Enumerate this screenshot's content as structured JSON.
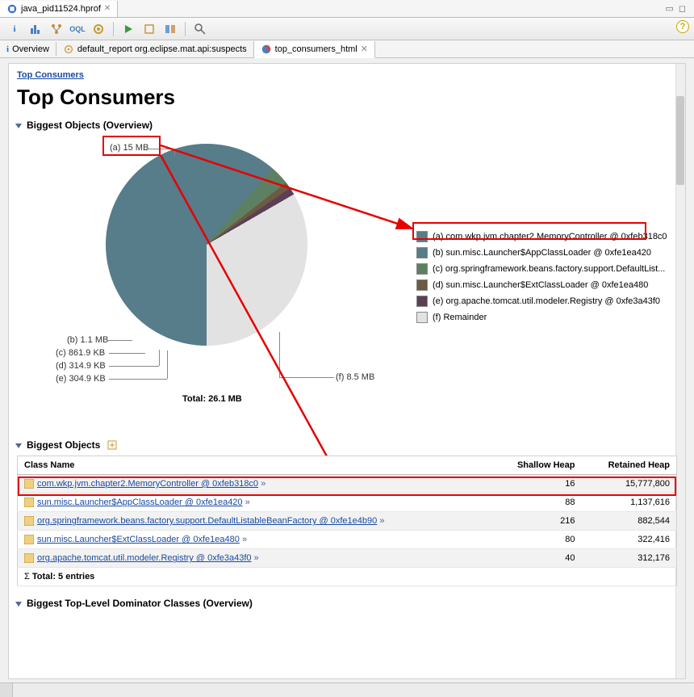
{
  "editor_tab": {
    "label": "java_pid11524.hprof"
  },
  "sub_tabs": {
    "overview": "Overview",
    "default_report": "default_report  org.eclipse.mat.api:suspects",
    "top_consumers": "top_consumers_html"
  },
  "breadcrumb": "Top Consumers",
  "page_title": "Top Consumers",
  "sections": {
    "overview": "Biggest Objects (Overview)",
    "biggest_objects": "Biggest Objects",
    "dominator": "Biggest Top-Level Dominator Classes (Overview)"
  },
  "pie": {
    "total_label": "Total: 26.1 MB",
    "labels": {
      "a": "(a)  15 MB",
      "b": "(b)  1.1 MB",
      "c": "(c)  861.9 KB",
      "d": "(d)  314.9 KB",
      "e": "(e)  304.9 KB",
      "f": "(f)  8.5 MB"
    }
  },
  "legend": [
    {
      "key": "a",
      "color": "#577c8a",
      "text": "(a)  com.wkp.jvm.chapter2.MemoryController @ 0xfeb318c0"
    },
    {
      "key": "b",
      "color": "#577c8a",
      "text": "(b)  sun.misc.Launcher$AppClassLoader @ 0xfe1ea420"
    },
    {
      "key": "c",
      "color": "#5e8062",
      "text": "(c)  org.springframework.beans.factory.support.DefaultList..."
    },
    {
      "key": "d",
      "color": "#6d5a40",
      "text": "(d)  sun.misc.Launcher$ExtClassLoader @ 0xfe1ea480"
    },
    {
      "key": "e",
      "color": "#5a3f55",
      "text": "(e)  org.apache.tomcat.util.modeler.Registry @ 0xfe3a43f0"
    },
    {
      "key": "f",
      "color": "#e2e2e2",
      "text": "(f)  Remainder"
    }
  ],
  "table": {
    "columns": {
      "name": "Class Name",
      "shallow": "Shallow Heap",
      "retained": "Retained Heap"
    },
    "rows": [
      {
        "name": "com.wkp.jvm.chapter2.MemoryController @ 0xfeb318c0",
        "shallow": "16",
        "retained": "15,777,800"
      },
      {
        "name": "sun.misc.Launcher$AppClassLoader @ 0xfe1ea420",
        "shallow": "88",
        "retained": "1,137,616"
      },
      {
        "name": "org.springframework.beans.factory.support.DefaultListableBeanFactory @ 0xfe1e4b90",
        "shallow": "216",
        "retained": "882,544"
      },
      {
        "name": "sun.misc.Launcher$ExtClassLoader @ 0xfe1ea480",
        "shallow": "80",
        "retained": "322,416"
      },
      {
        "name": "org.apache.tomcat.util.modeler.Registry @ 0xfe3a43f0",
        "shallow": "40",
        "retained": "312,176"
      }
    ],
    "total_label": "Total: 5 entries"
  },
  "chart_data": {
    "type": "pie",
    "title": "Biggest Objects (Overview)",
    "total_label": "Total: 26.1 MB",
    "total_value_mb": 26.1,
    "slices": [
      {
        "key": "a",
        "label": "com.wkp.jvm.chapter2.MemoryController @ 0xfeb318c0",
        "value_mb": 15.0,
        "display": "15 MB",
        "color": "#577c8a"
      },
      {
        "key": "b",
        "label": "sun.misc.Launcher$AppClassLoader @ 0xfe1ea420",
        "value_mb": 1.1,
        "display": "1.1 MB",
        "color": "#577c8a"
      },
      {
        "key": "c",
        "label": "org.springframework.beans.factory.support.DefaultListableBeanFactory",
        "value_mb": 0.842,
        "display": "861.9 KB",
        "color": "#5e8062"
      },
      {
        "key": "d",
        "label": "sun.misc.Launcher$ExtClassLoader @ 0xfe1ea480",
        "value_mb": 0.308,
        "display": "314.9 KB",
        "color": "#6d5a40"
      },
      {
        "key": "e",
        "label": "org.apache.tomcat.util.modeler.Registry @ 0xfe3a43f0",
        "value_mb": 0.298,
        "display": "304.9 KB",
        "color": "#5a3f55"
      },
      {
        "key": "f",
        "label": "Remainder",
        "value_mb": 8.5,
        "display": "8.5 MB",
        "color": "#e2e2e2"
      }
    ]
  }
}
